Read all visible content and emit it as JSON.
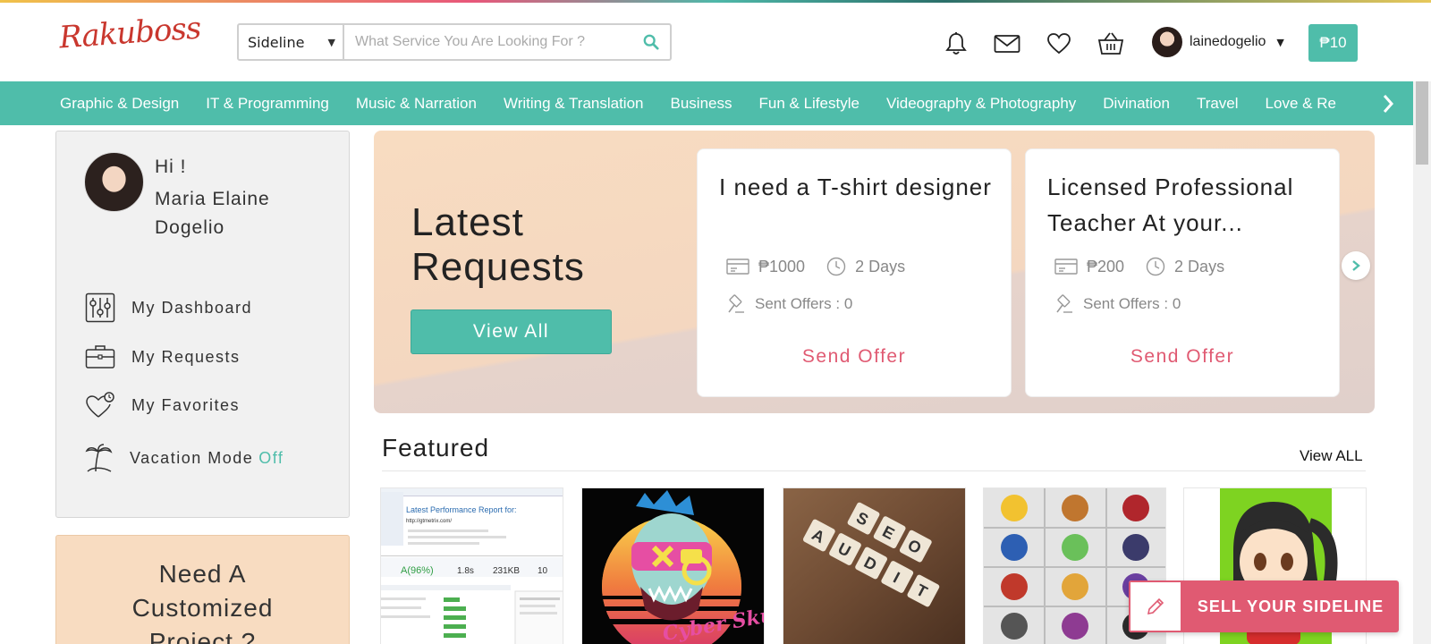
{
  "brand": {
    "logo_text": "Rakuboss",
    "accent_color": "#4fbdaa",
    "cta_color": "#e05a72",
    "logo_color": "#c9372e"
  },
  "search": {
    "category": "Sideline",
    "placeholder": "What Service You Are Looking For ?"
  },
  "header": {
    "icons": [
      "bell-icon",
      "mail-icon",
      "heart-icon",
      "basket-icon"
    ],
    "username": "lainedogelio",
    "wallet_label": "₱10"
  },
  "categories": [
    "Graphic & Design",
    "IT & Programming",
    "Music & Narration",
    "Writing & Translation",
    "Business",
    "Fun & Lifestyle",
    "Videography & Photography",
    "Divination",
    "Travel",
    "Love & Re"
  ],
  "sidebar": {
    "greeting": "Hi !",
    "full_name": "Maria Elaine Dogelio",
    "menu": {
      "dashboard": "My Dashboard",
      "requests": "My Requests",
      "favorites": "My Favorites",
      "vacation": "Vacation Mode",
      "vacation_state": "Off"
    },
    "custom_project": "Need A Customized Project ?"
  },
  "latest_requests": {
    "title": "Latest Requests",
    "view_all": "View All",
    "items": [
      {
        "title": "I need a T-shirt designer",
        "budget": "₱1000",
        "duration": "2 Days",
        "offers": "Sent Offers : 0",
        "action": "Send Offer"
      },
      {
        "title": "Licensed Professional Teacher At your...",
        "budget": "₱200",
        "duration": "2 Days",
        "offers": "Sent Offers : 0",
        "action": "Send Offer"
      }
    ]
  },
  "featured": {
    "title": "Featured",
    "view_all": "View ALL",
    "items": [
      {
        "image": "performance-report-thumbnail",
        "report_title": "Latest Performance Report for:",
        "report_url": "http://gtmetrix.com/"
      },
      {
        "image": "cyber-skull-thumbnail",
        "art_text": "Cyber Skull"
      },
      {
        "image": "seo-audit-thumbnail"
      },
      {
        "image": "esports-logos-thumbnail"
      },
      {
        "image": "chibi-avatar-thumbnail"
      }
    ]
  },
  "sell_cta": {
    "label": "SELL YOUR SIDELINE"
  }
}
